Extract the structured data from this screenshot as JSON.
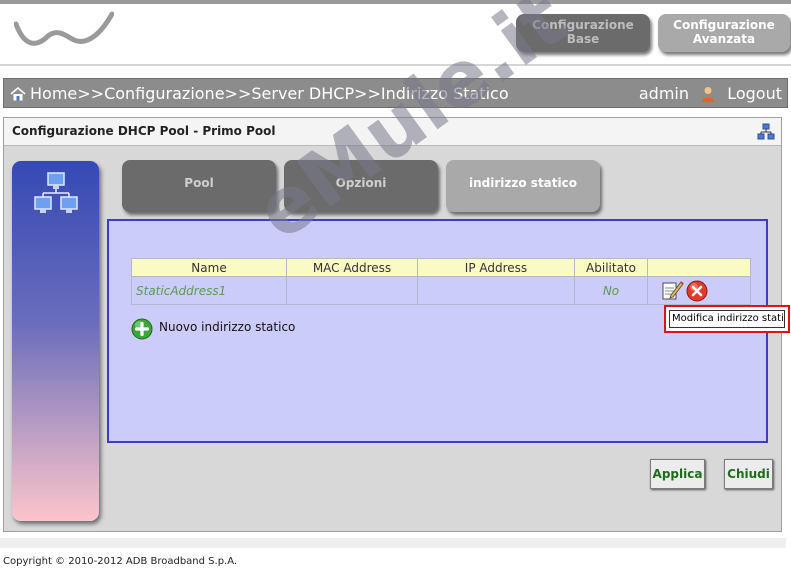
{
  "header": {
    "logo_icon": "wave-logo-icon",
    "config_base_label": "Configurazione\nBase",
    "config_advanced_label": "Configurazione\nAvanzata"
  },
  "navbar": {
    "home_icon": "home-icon",
    "crumbs": [
      "Home",
      ">>",
      "Configurazione",
      ">>",
      "Server DHCP",
      ">>",
      "Indirizzo Statico"
    ],
    "user": "admin",
    "user_icon": "user-icon",
    "logout": "Logout"
  },
  "panel": {
    "title": "Configurazione DHCP Pool - Primo Pool",
    "network_icon": "network-icon"
  },
  "tabs": [
    {
      "label": "Pool",
      "active": false
    },
    {
      "label": "Opzioni",
      "active": false
    },
    {
      "label": "indirizzo statico",
      "active": true
    }
  ],
  "table": {
    "columns": [
      "Name",
      "MAC Address",
      "IP Address",
      "Abilitato",
      ""
    ],
    "rows": [
      {
        "name": "StaticAddress1",
        "mac": "",
        "ip": "",
        "enabled": "No"
      }
    ]
  },
  "add_label": "Nuovo indirizzo statico",
  "tooltip": "Modifica indirizzo statico",
  "buttons": {
    "apply": "Applica",
    "close": "Chiudi"
  },
  "watermark": "eMule.it",
  "footer": "Copyright © 2010-2012 ADB Broadband S.p.A.",
  "colors": {
    "accent": "#3d3dbf",
    "button_text": "#1c6e1c",
    "highlight": "#e01212"
  }
}
